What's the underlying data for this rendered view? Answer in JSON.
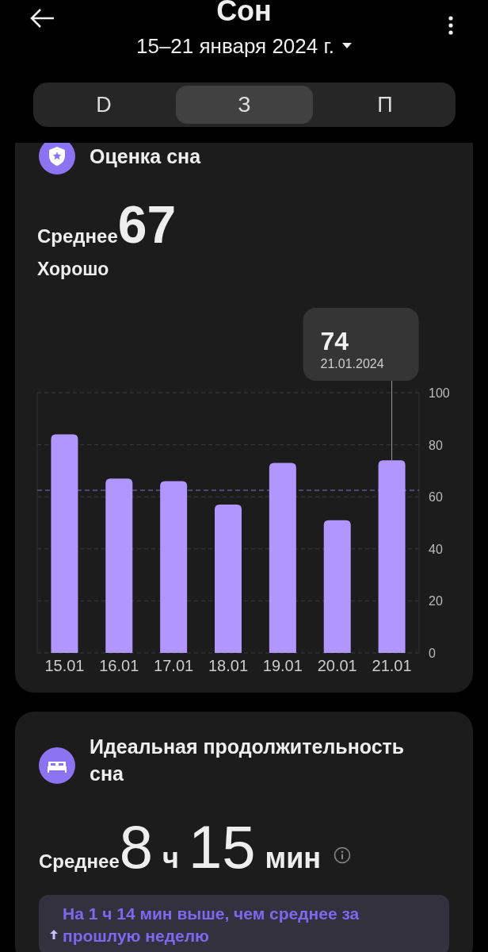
{
  "header": {
    "title": "Сон",
    "date_range": "15–21 января 2024 г."
  },
  "tabs": [
    {
      "label": "D",
      "selected": false
    },
    {
      "label": "З",
      "selected": true
    },
    {
      "label": "П",
      "selected": false
    }
  ],
  "score_card": {
    "title": "Оценка сна",
    "average_label": "Среднее",
    "average_value": "67",
    "rating": "Хорошо",
    "tooltip": {
      "value": "74",
      "date": "21.01.2024"
    },
    "chart_data": {
      "type": "bar",
      "categories": [
        "15.01",
        "16.01",
        "17.01",
        "18.01",
        "19.01",
        "20.01",
        "21.01"
      ],
      "series": [
        {
          "color": "#b196ff",
          "values": [
            84,
            67,
            66,
            57,
            73,
            51,
            74
          ]
        }
      ],
      "ylim": [
        0,
        100
      ],
      "yticks": [
        0,
        20,
        40,
        60,
        80,
        100
      ],
      "grid": true,
      "ref_lines": [
        {
          "axis": "y",
          "value": 62.5
        }
      ]
    }
  },
  "duration_card": {
    "title": "Идеальная продолжительность сна",
    "average_label": "Среднее",
    "value_parts": [
      {
        "kind": "number",
        "text": "8"
      },
      {
        "kind": "unit",
        "text": "ч"
      },
      {
        "kind": "number",
        "text": "15"
      },
      {
        "kind": "unit",
        "text": "мин"
      }
    ],
    "comparison": "На 1 ч 14 мин выше, чем среднее за прошлую неделю"
  }
}
